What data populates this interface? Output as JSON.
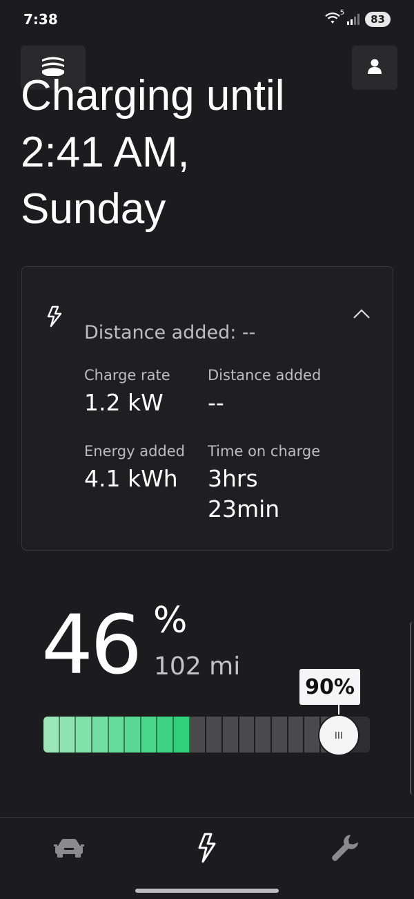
{
  "status_bar": {
    "time": "7:38",
    "wifi_label": "5",
    "battery": "83"
  },
  "headline": {
    "text": "Charging until\n2:41 AM,\nSunday"
  },
  "details": {
    "summary": "Distance added: --",
    "stats": [
      {
        "label": "Charge rate",
        "value": "1.2 kW"
      },
      {
        "label": "Distance added",
        "value": "--"
      },
      {
        "label": "Energy added",
        "value": "4.1 kWh"
      },
      {
        "label": "Time on charge",
        "value": "3hrs\n23min"
      }
    ]
  },
  "battery": {
    "percent": "46",
    "percent_sign": "%",
    "range": "102 mi",
    "charge_level": 0.46,
    "charge_limit_label": "90%",
    "charge_limit": 0.9
  },
  "colors": {
    "background": "#1c1c1e",
    "card_border": "#3a3a3c",
    "charge_green_light": "#9be6b8",
    "charge_green_dark": "#2fd07a",
    "segment_empty": "#4a4a4c"
  },
  "icons": {
    "menu": "stacked-menu-icon",
    "profile": "person-icon",
    "bolt": "lightning-bolt-icon",
    "chevron": "chevron-up-icon",
    "car": "car-icon",
    "charge": "lightning-bolt-icon",
    "service": "wrench-icon"
  }
}
